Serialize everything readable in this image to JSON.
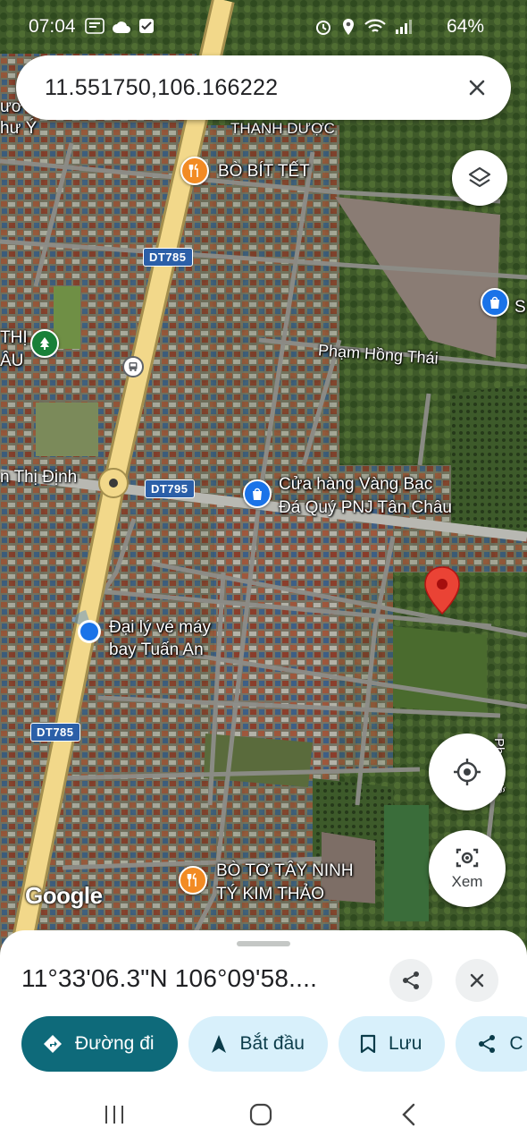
{
  "status_bar": {
    "time": "07:04",
    "battery": "64%"
  },
  "search": {
    "query": "11.551750,106.166222"
  },
  "map": {
    "places": {
      "bo_bit_tet": "BÒ BÍT TẾT",
      "thanh_duoc": "THANH DƯỢC",
      "pham_hong_thai": "Phạm Hồng Thái",
      "thi_dinh": "n Thị Định",
      "pnj_line1": "Cửa hàng Vàng Bạc",
      "pnj_line2": "Đá Quý PNJ Tân Châu",
      "agency_line1": "Đại lý vé máy",
      "agency_line2": "bay Tuấn An",
      "bo_to_line1": "BÒ TƠ TÂY NINH",
      "bo_to_line2": "TÝ KIM THẢO",
      "left_edge_1": "ươ",
      "left_edge_2": "hư Ý",
      "left_edge_3": "THỊ",
      "left_edge_4": "ÂU",
      "right_edge_s": "S",
      "right_edge_street": "Phạm Hồ"
    },
    "road_shields": [
      "DT785",
      "DT795",
      "DT785"
    ],
    "logo": "Google"
  },
  "controls": {
    "lens_label": "Xem"
  },
  "sheet": {
    "coordinates": "11°33'06.3\"N 106°09'58....",
    "actions": [
      {
        "label": "Đường đi",
        "icon": "directions-icon"
      },
      {
        "label": "Bắt đầu",
        "icon": "navigation-arrow-icon"
      },
      {
        "label": "Lưu",
        "icon": "bookmark-icon"
      },
      {
        "label": "C",
        "icon": "share-icon"
      }
    ]
  },
  "colors": {
    "accent": "#0e6a7a",
    "chip_bg": "#d8f0fb",
    "pin": "#ea4335",
    "location_dot": "#1a73e8",
    "road_major": "#f2d88a"
  }
}
